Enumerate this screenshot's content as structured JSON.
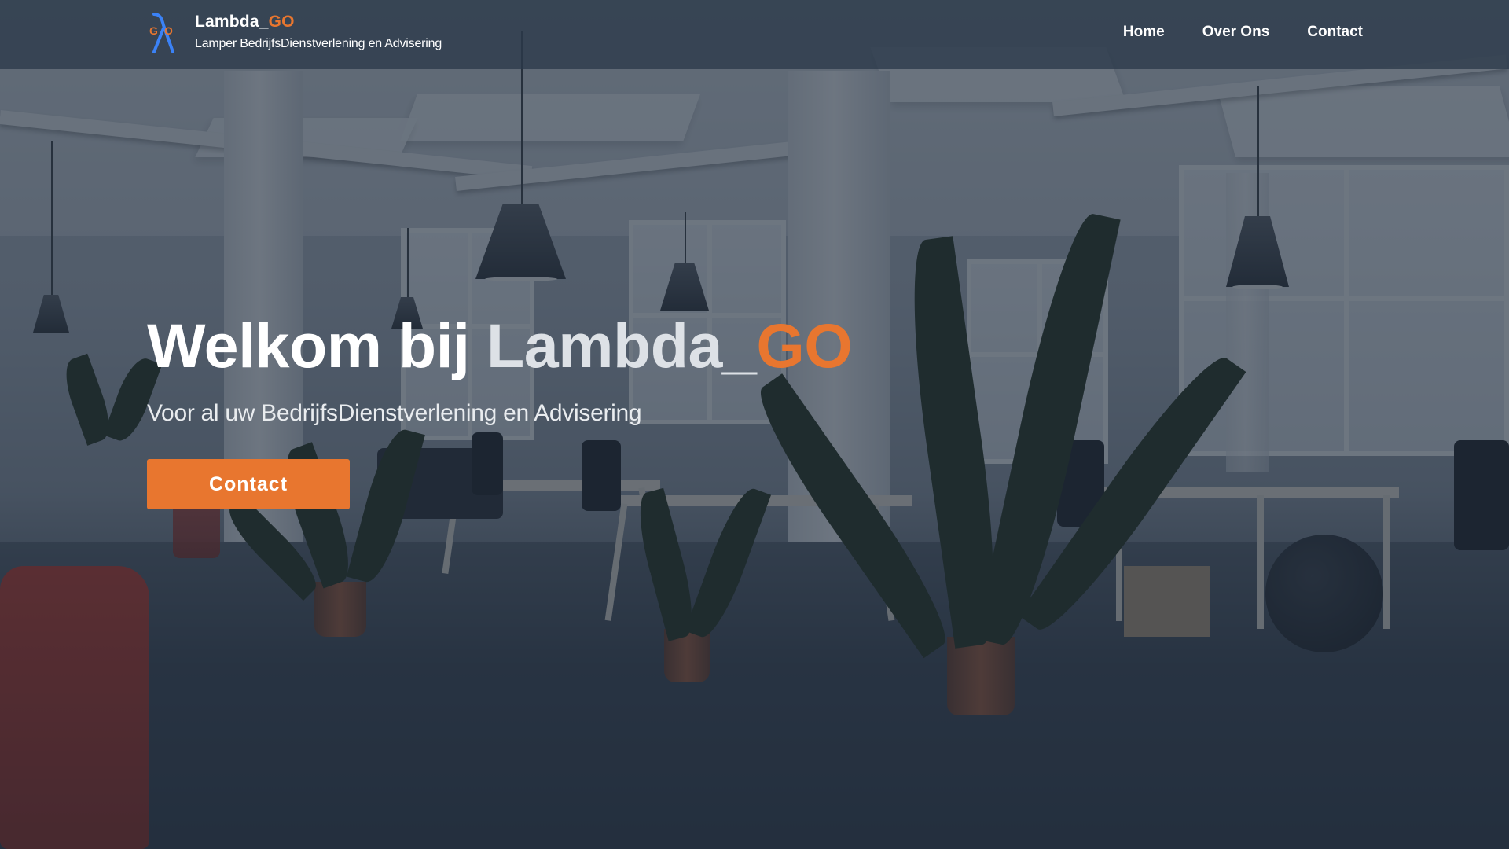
{
  "header": {
    "brand_name_main": "Lambda_",
    "brand_name_accent": "GO",
    "tagline": "Lamper BedrijfsDienstverlening en Advisering",
    "logo_icon": "lambda-go-logo"
  },
  "nav": {
    "items": [
      {
        "label": "Home"
      },
      {
        "label": "Over Ons"
      },
      {
        "label": "Contact"
      }
    ]
  },
  "hero": {
    "title_prefix": "Welkom bij ",
    "title_brand": "Lambda_",
    "title_accent": "GO",
    "subtitle": "Voor al uw BedrijfsDienstverlening en Advisering",
    "cta_label": "Contact",
    "background": "office-interior-photo"
  },
  "colors": {
    "accent": "#e8762f",
    "header_bg": "#2c3a4a",
    "overlay": "#1c2838",
    "text": "#ffffff"
  }
}
